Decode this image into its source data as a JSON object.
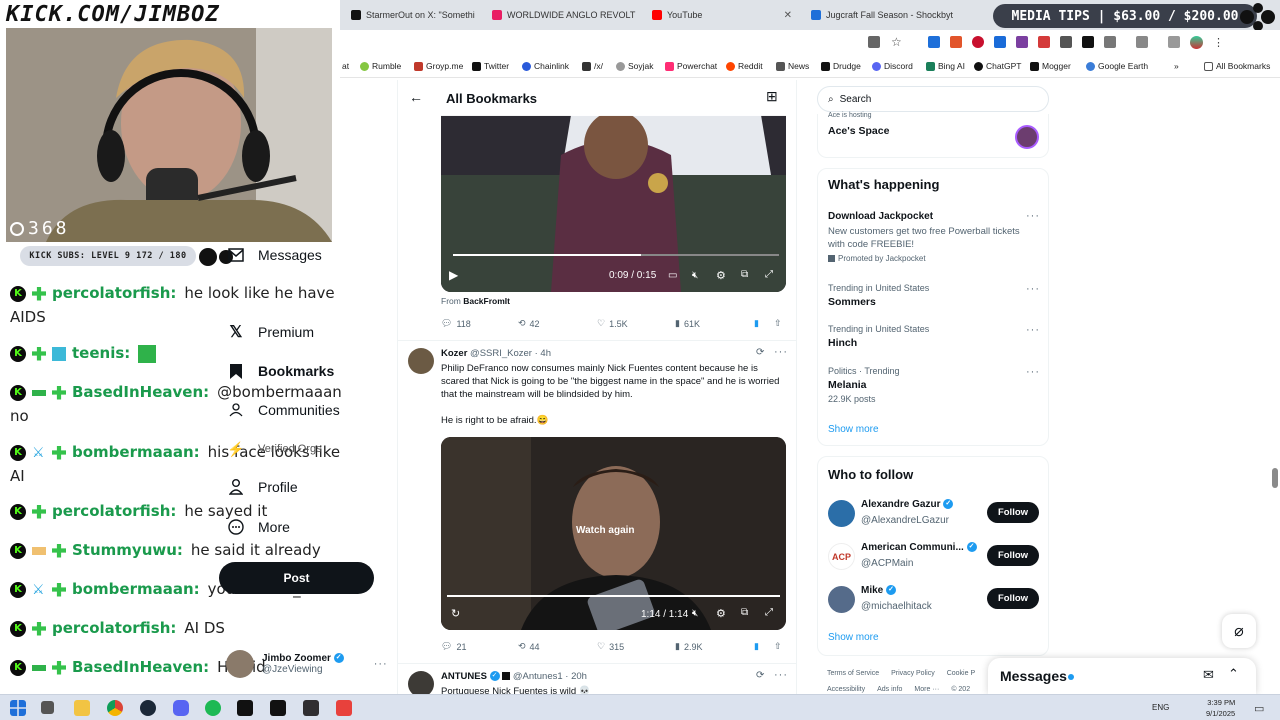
{
  "overlay": {
    "channel_logo": "KICK.COM/JIMBOZ",
    "viewer_count": "368",
    "kick_subs": "KICK SUBS: LEVEL 9 172 / 180",
    "media_tips": "MEDIA TIPS | $63.00 / $200.00",
    "chat": [
      {
        "user": "percolatorfish:",
        "msg": "he look like he have",
        "cont": "AIDS",
        "ucolor": "#1a9a4c"
      },
      {
        "user": "teenis:",
        "msg": "",
        "cont": "",
        "ucolor": "#1a9a4c"
      },
      {
        "user": "BasedInHeaven:",
        "msg": "@bombermaaan",
        "cont": "no",
        "ucolor": "#1a9a4c"
      },
      {
        "user": "bombermaaan:",
        "msg": "his face looks like",
        "cont": "AI",
        "ucolor": "#1a9a4c"
      },
      {
        "user": "percolatorfish:",
        "msg": "he sayed it",
        "cont": "",
        "ucolor": "#1a9a4c"
      },
      {
        "user": "Stummyuwu:",
        "msg": "he said it already",
        "cont": "",
        "ucolor": "#1a9a4c"
      },
      {
        "user": "bombermaaan:",
        "msg": "you missed_it",
        "cont": "",
        "ucolor": "#1a9a4c"
      },
      {
        "user": "percolatorfish:",
        "msg": "AI DS",
        "cont": "",
        "ucolor": "#1a9a4c"
      },
      {
        "user": "BasedInHeaven:",
        "msg": "He did",
        "cont": "",
        "ucolor": "#1a9a4c"
      }
    ]
  },
  "browser": {
    "tabs": [
      {
        "label": "StarmerOut on X: \"Somethi",
        "color": "#111"
      },
      {
        "label": "WORLDWIDE ANGLO REVOLT",
        "color": "#e91e63"
      },
      {
        "label": "YouTube",
        "color": "#ff0000"
      },
      {
        "label": "Jugcraft Fall Season - Shockbyt",
        "color": "#1e6fd9"
      }
    ],
    "bookmarks": [
      {
        "label": "at",
        "color": "#fff"
      },
      {
        "label": "Rumble",
        "color": "#85c742"
      },
      {
        "label": "Groyp.me",
        "color": "#c0392b"
      },
      {
        "label": "Twitter",
        "color": "#111"
      },
      {
        "label": "Chainlink",
        "color": "#2a5ada"
      },
      {
        "label": "/x/",
        "color": "#333"
      },
      {
        "label": "Soyjak",
        "color": "#999"
      },
      {
        "label": "Powerchat",
        "color": "#ff2d74"
      },
      {
        "label": "Reddit",
        "color": "#ff4500"
      },
      {
        "label": "News",
        "color": "#555"
      },
      {
        "label": "Drudge",
        "color": "#111"
      },
      {
        "label": "Discord",
        "color": "#5865f2"
      },
      {
        "label": "Bing AI",
        "color": "#1a7f5a"
      },
      {
        "label": "ChatGPT",
        "color": "#111"
      },
      {
        "label": "Mogger",
        "color": "#111"
      },
      {
        "label": "Google Earth",
        "color": "#3b7dd8"
      },
      {
        "label": "All Bookmarks",
        "color": "#555"
      }
    ]
  },
  "nav": {
    "messages": "Messages",
    "premium": "Premium",
    "bookmarks": "Bookmarks",
    "communities": "Communities",
    "verified_orgs": "Verified Orgs",
    "profile": "Profile",
    "more": "More",
    "post": "Post",
    "account_name": "Jimbo Zoomer",
    "account_handle": "@JzeViewing"
  },
  "main": {
    "header": "All Bookmarks",
    "post1": {
      "time": "0:09 / 0:15",
      "from_label": "From",
      "from_source": "BackFromIt",
      "replies": "118",
      "reposts": "42",
      "likes": "1.5K",
      "views": "61K"
    },
    "post2": {
      "name": "Kozer",
      "handle": "@SSRI_Kozer · 4h",
      "text": "Philip DeFranco now consumes mainly Nick Fuentes content because he is scared that Nick is going to be \"the biggest name in the space\" and he is worried that the mainstream will be blindsided by him.",
      "text2": "He is right to be afraid.😄",
      "overlay": "Watch again",
      "time": "1:14 / 1:14",
      "replies": "21",
      "reposts": "44",
      "likes": "315",
      "views": "2.9K"
    },
    "post3": {
      "name": "ANTUNES",
      "handle": "@Antunes1 · 20h",
      "text": "Portuguese Nick Fuentes is wild 💀"
    }
  },
  "right": {
    "search_placeholder": "Search",
    "space_top": "Ace is hosting",
    "space_title": "Ace's Space",
    "happening_title": "What's happening",
    "ad": {
      "title": "Download Jackpocket",
      "body": "New customers get two free Powerball tickets with code FREEBIE!",
      "promo": "Promoted by Jackpocket"
    },
    "trends": [
      {
        "ctx": "Trending in United States",
        "name": "Sommers",
        "posts": ""
      },
      {
        "ctx": "Trending in United States",
        "name": "Hinch",
        "posts": ""
      },
      {
        "ctx": "Politics · Trending",
        "name": "Melania",
        "posts": "22.9K posts"
      }
    ],
    "show_more": "Show more",
    "who_title": "Who to follow",
    "who": [
      {
        "name": "Alexandre Gazur",
        "handle": "@AlexandreLGazur",
        "color": "#2b6ea8"
      },
      {
        "name": "American Communi...",
        "handle": "@ACPMain",
        "color": "#c0392b"
      },
      {
        "name": "Mike",
        "handle": "@michaelhitack",
        "color": "#556b8a"
      }
    ],
    "follow": "Follow",
    "footer": [
      "Terms of Service",
      "Privacy Policy",
      "Cookie P",
      "Accessibility",
      "Ads info",
      "More ···",
      "© 202"
    ],
    "messages_drawer": "Messages"
  },
  "taskbar": {
    "lang": "ENG",
    "time": "3:39 PM",
    "date": "9/1/2025"
  }
}
